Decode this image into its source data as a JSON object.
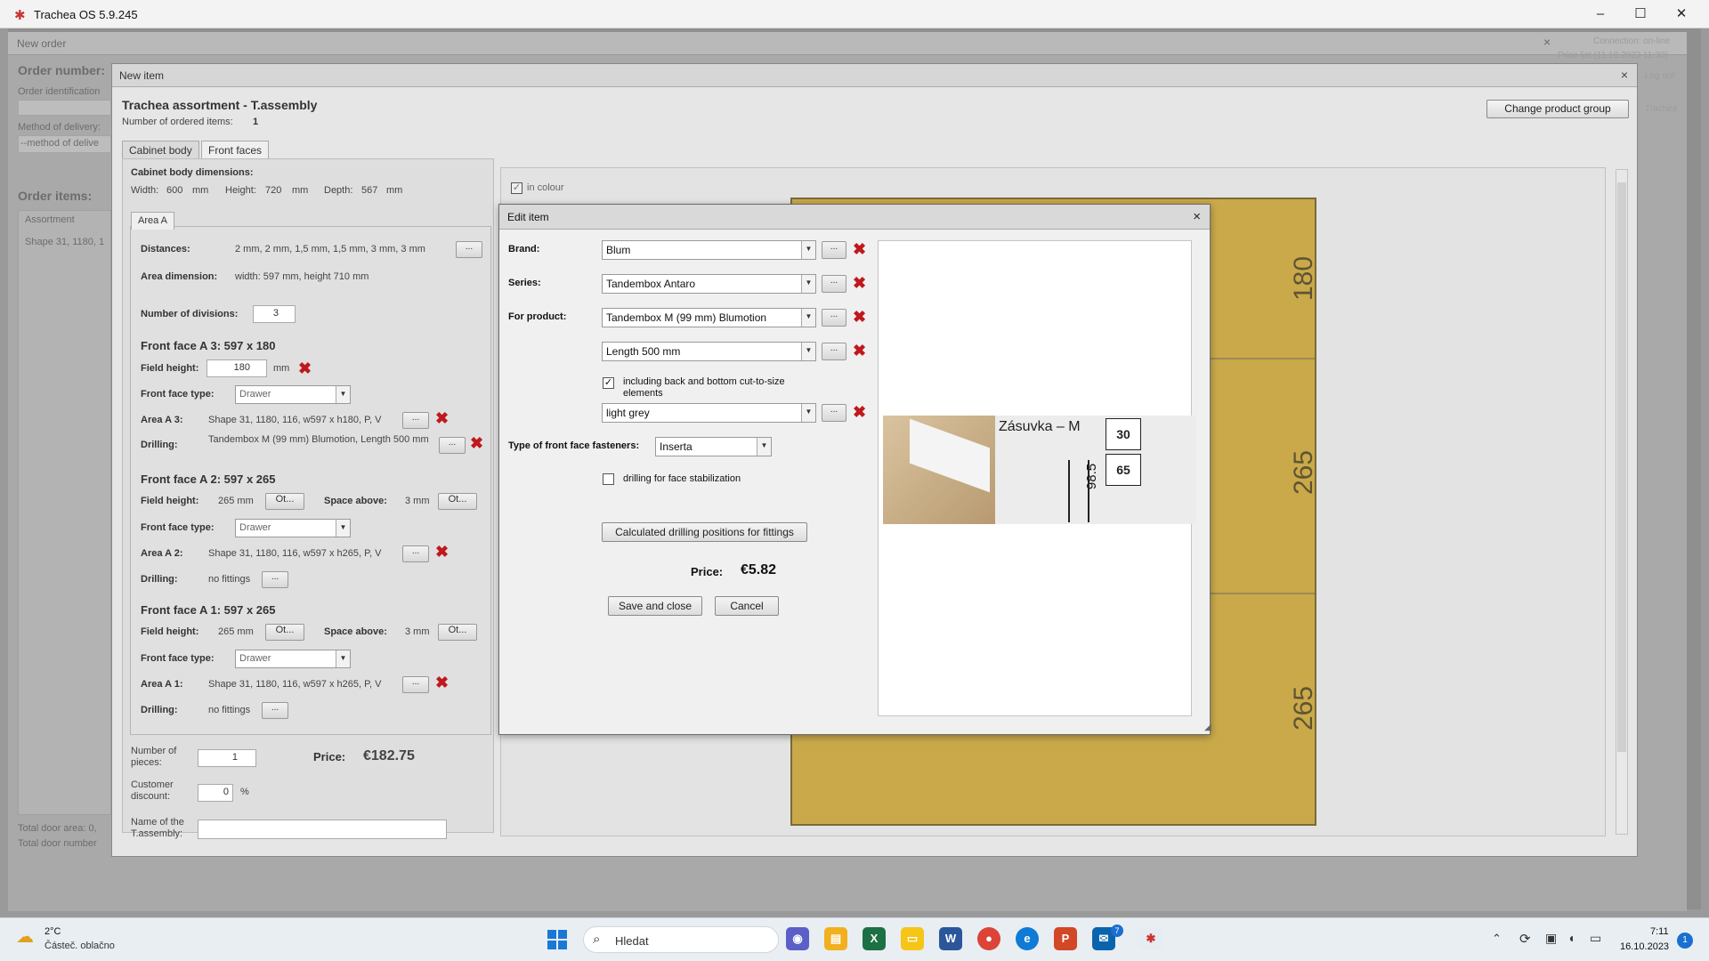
{
  "os_window": {
    "title": "Trachea OS 5.9.245",
    "minimize": "–",
    "maximize": "☐",
    "close": "✕"
  },
  "new_order": {
    "title": "New order",
    "order_number_label": "Order number:",
    "order_identification_label": "Order identification",
    "method_delivery_label": "Method of delivery:",
    "method_delivery_value": "--method of delive",
    "order_items_label": "Order items:",
    "assortment_label": "Assortment",
    "assortment_row": "Shape 31, 1180, 1",
    "total_door_area": "Total door area: 0,",
    "total_door_number": "Total door number",
    "connection": "Connection: on-line",
    "price_list": "Price list (11.10.2023 11:30)",
    "logout": "Log out",
    "trachea": "Trachea"
  },
  "new_item": {
    "title": "New item",
    "heading": "Trachea assortment - T.assembly",
    "ordered_label": "Number of ordered items:",
    "ordered_value": "1",
    "change_group": "Change product group",
    "tabs": [
      "Cabinet body",
      "Front faces"
    ],
    "cab_dims_label": "Cabinet body dimensions:",
    "width_label": "Width:",
    "width_value": "600",
    "width_unit": "mm",
    "height_label": "Height:",
    "height_value": "720",
    "height_unit": "mm",
    "depth_label": "Depth:",
    "depth_value": "567",
    "depth_unit": "mm",
    "area_tab": "Area A",
    "distances_label": "Distances:",
    "distances_value": "2 mm, 2 mm, 1,5 mm, 1,5 mm, 3 mm, 3 mm",
    "area_dim_label": "Area dimension:",
    "area_dim_value": "width: 597 mm, height 710 mm",
    "divisions_label": "Number of divisions:",
    "divisions_value": "3",
    "a3": {
      "title": "Front face A 3: 597 x 180",
      "field_height_label": "Field height:",
      "field_height_value": "180",
      "unit": "mm",
      "type_label": "Front face type:",
      "type_value": "Drawer",
      "area_label": "Area A 3:",
      "area_value": "Shape 31, 1180, 116, w597 x h180, P, V",
      "drilling_label": "Drilling:",
      "drilling_value": "Tandembox M (99 mm) Blumotion, Length 500 mm"
    },
    "a2": {
      "title": "Front face A 2: 597 x 265",
      "field_height_label": "Field height:",
      "field_height_value": "265 mm",
      "ot": "Ot...",
      "space_label": "Space above:",
      "space_value": "3 mm",
      "type_label": "Front face type:",
      "type_value": "Drawer",
      "area_label": "Area A 2:",
      "area_value": "Shape 31, 1180, 116, w597 x h265, P, V",
      "drilling_label": "Drilling:",
      "drilling_value": "no fittings"
    },
    "a1": {
      "title": "Front face A 1: 597 x 265",
      "field_height_label": "Field height:",
      "field_height_value": "265 mm",
      "ot": "Ot...",
      "space_label": "Space above:",
      "space_value": "3 mm",
      "type_label": "Front face type:",
      "type_value": "Drawer",
      "area_label": "Area A 1:",
      "area_value": "Shape 31, 1180, 116, w597 x h265, P, V",
      "drilling_label": "Drilling:",
      "drilling_value": "no fittings"
    },
    "pieces_label": "Number of pieces:",
    "pieces_value": "1",
    "price_label": "Price:",
    "price_value": "€182.75",
    "discount_label": "Customer discount:",
    "discount_value": "0",
    "discount_unit": "%",
    "name_label": "Name of the T.assembly:",
    "in_colour": "in colour",
    "dots": "...",
    "drawing": [
      "180",
      "265",
      "265"
    ]
  },
  "edit_item": {
    "title": "Edit item",
    "brand_label": "Brand:",
    "brand_value": "Blum",
    "series_label": "Series:",
    "series_value": "Tandembox Antaro",
    "product_label": "For product:",
    "product_value": "Tandembox M (99 mm) Blumotion",
    "length_value": "Length 500 mm",
    "including_label": "including back and bottom cut-to-size elements",
    "colour_value": "light grey",
    "fasteners_label": "Type of front face fasteners:",
    "fasteners_value": "Inserta",
    "stabilization_label": "drilling for face stabilization",
    "calc_button": "Calculated drilling positions for fittings",
    "price_label": "Price:",
    "price_value": "€5.82",
    "save_button": "Save and close",
    "cancel_button": "Cancel",
    "dots": "...",
    "preview": {
      "title": "Zásuvka – M",
      "dim_a": "30",
      "dim_b": "65",
      "dim_c": "98.5"
    }
  },
  "taskbar": {
    "weather_temp": "2°C",
    "weather_desc": "Částeč. oblačno",
    "search_placeholder": "Hledat",
    "time": "7:11",
    "date": "16.10.2023",
    "notif": "1",
    "mail_badge": "7"
  },
  "colors": {
    "cabinet": "#c9a94a",
    "delete_red": "#c0181d",
    "taskbar": "#e9eef3"
  }
}
